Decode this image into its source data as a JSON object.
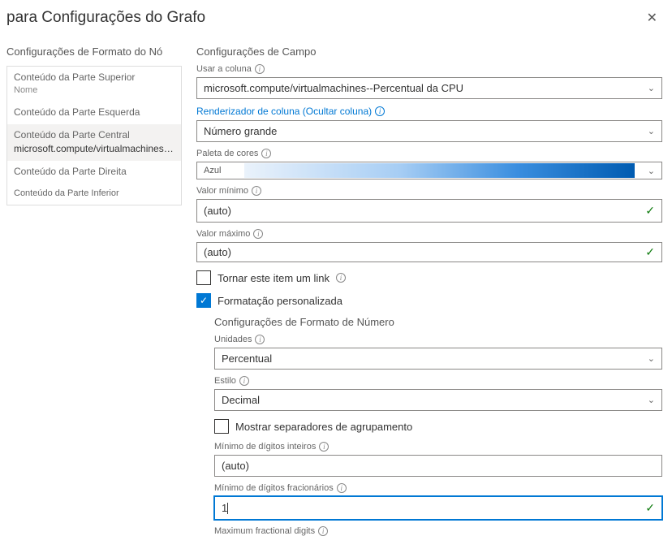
{
  "header": {
    "title": "para Configurações do Grafo"
  },
  "leftPanel": {
    "title": "Configurações de Formato do Nó",
    "items": [
      {
        "label": "Conteúdo da Parte Superior",
        "sub": "Nome"
      },
      {
        "label": "Conteúdo da Parte Esquerda",
        "sub": ""
      },
      {
        "label": "Conteúdo da Parte Central",
        "detail": "microsoft.compute/virtualmachines--Percentual da CPU"
      },
      {
        "label": "Conteúdo da Parte Direita",
        "sub": ""
      },
      {
        "label": "Conteúdo da Parte Inferior",
        "sub": ""
      }
    ]
  },
  "fieldSettings": {
    "title": "Configurações de Campo",
    "useColumn": {
      "label": "Usar a coluna",
      "value": "microsoft.compute/virtualmachines--Percentual da CPU"
    },
    "columnRenderer": {
      "label": "Renderizador de coluna (Ocultar coluna)",
      "value": "Número grande"
    },
    "colorPalette": {
      "label": "Paleta de cores",
      "value": "Azul"
    },
    "minValue": {
      "label": "Valor mínimo",
      "value": "(auto)"
    },
    "maxValue": {
      "label": "Valor máximo",
      "value": "(auto)"
    },
    "makeLink": {
      "label": "Tornar este item um link"
    },
    "customFormat": {
      "label": "Formatação personalizada"
    }
  },
  "numberFormat": {
    "title": "Configurações de Formato de Número",
    "units": {
      "label": "Unidades",
      "value": "Percentual"
    },
    "style": {
      "label": "Estilo",
      "value": "Decimal"
    },
    "showGrouping": {
      "label": "Mostrar separadores de agrupamento"
    },
    "minIntDigits": {
      "label": "Mínimo de dígitos inteiros",
      "value": "(auto)"
    },
    "minFracDigits": {
      "label": "Mínimo de dígitos fracionários",
      "value": "1"
    },
    "maxFracDigits": {
      "label": "Maximum fractional digits"
    }
  }
}
